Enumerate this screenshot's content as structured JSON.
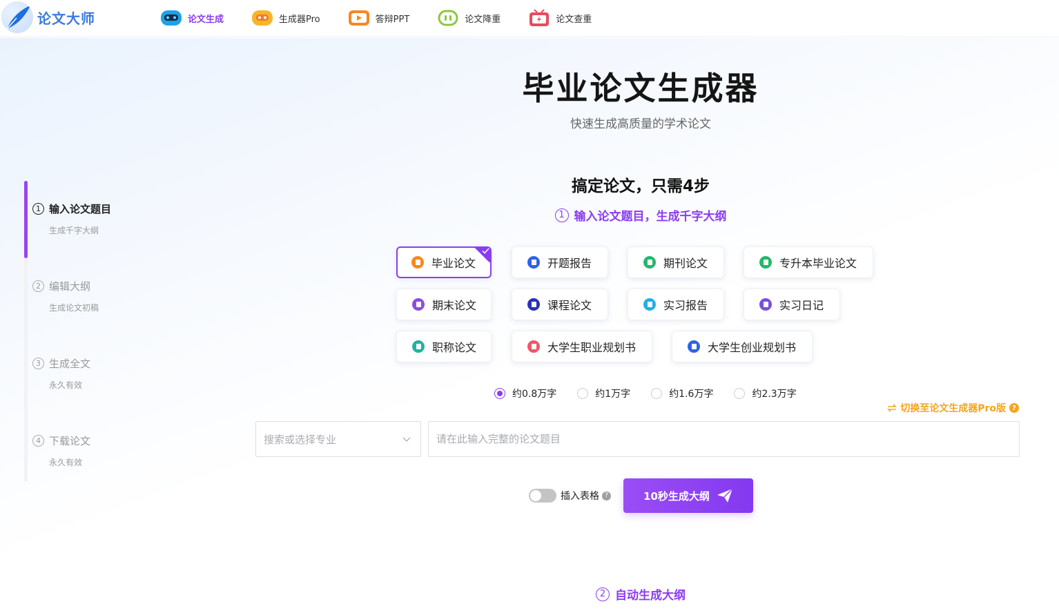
{
  "brand": {
    "name": "论文大师"
  },
  "nav": [
    {
      "label": "论文生成",
      "icon": "robot-icon",
      "active": true
    },
    {
      "label": "生成器Pro",
      "icon": "robot-pro-icon",
      "active": false
    },
    {
      "label": "答辩PPT",
      "icon": "ppt-icon",
      "active": false
    },
    {
      "label": "论文降重",
      "icon": "reduce-icon",
      "active": false
    },
    {
      "label": "论文查重",
      "icon": "check-icon",
      "active": false
    }
  ],
  "hero": {
    "title": "毕业论文生成器",
    "subtitle": "快速生成高质量的学术论文",
    "steps_headline": "搞定论文，只需4步",
    "step1_hint": "输入论文题目，生成千字大纲",
    "step1_num": "1",
    "step2_hint": "自动生成大纲",
    "step2_num": "2"
  },
  "steps": [
    {
      "num": "1",
      "title": "输入论文题目",
      "sub": "生成千字大纲",
      "active": true
    },
    {
      "num": "2",
      "title": "编辑大纲",
      "sub": "生成论文初稿",
      "active": false
    },
    {
      "num": "3",
      "title": "生成全文",
      "sub": "永久有效",
      "active": false
    },
    {
      "num": "4",
      "title": "下载论文",
      "sub": "永久有效",
      "active": false
    }
  ],
  "paper_types": [
    {
      "label": "毕业论文",
      "color": "#f5891f",
      "selected": true
    },
    {
      "label": "开题报告",
      "color": "#2f62e8",
      "selected": false
    },
    {
      "label": "期刊论文",
      "color": "#23b86c",
      "selected": false
    },
    {
      "label": "专升本毕业论文",
      "color": "#23b86c",
      "selected": false
    },
    {
      "label": "期末论文",
      "color": "#8b4fd9",
      "selected": false
    },
    {
      "label": "课程论文",
      "color": "#2b2fb8",
      "selected": false
    },
    {
      "label": "实习报告",
      "color": "#1eb0e8",
      "selected": false
    },
    {
      "label": "实习日记",
      "color": "#7a4fe0",
      "selected": false
    },
    {
      "label": "职称论文",
      "color": "#22b3a0",
      "selected": false
    },
    {
      "label": "大学生职业规划书",
      "color": "#f0566a",
      "selected": false
    },
    {
      "label": "大学生创业规划书",
      "color": "#2f62e8",
      "selected": false
    }
  ],
  "word_counts": [
    {
      "label": "约0.8万字",
      "checked": true
    },
    {
      "label": "约1万字",
      "checked": false
    },
    {
      "label": "约1.6万字",
      "checked": false
    },
    {
      "label": "约2.3万字",
      "checked": false
    }
  ],
  "pro_switch": {
    "label": "切换至论文生成器Pro版"
  },
  "form": {
    "major_placeholder": "搜索或选择专业",
    "title_placeholder": "请在此输入完整的论文题目",
    "insert_table_label": "插入表格",
    "generate_button": "10秒生成大纲"
  },
  "colors": {
    "accent": "#8b3cf2",
    "brand_blue": "#3b7ae0",
    "pro_orange": "#f4a51c"
  }
}
